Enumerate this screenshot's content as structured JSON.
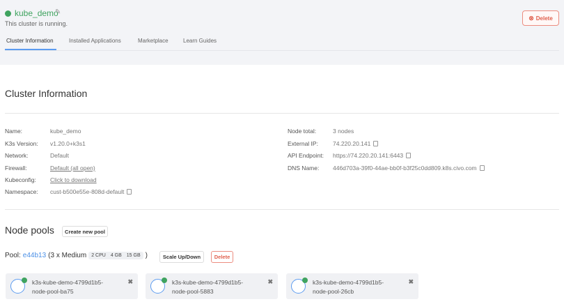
{
  "header": {
    "cluster_name": "kube_demo",
    "status": "This cluster is running.",
    "delete_label": "Delete"
  },
  "tabs": [
    "Cluster Information",
    "Installed Applications",
    "Marketplace",
    "Learn Guides"
  ],
  "info": {
    "heading": "Cluster Information",
    "left": [
      {
        "label": "Name:",
        "value": "kube_demo"
      },
      {
        "label": "K3s Version:",
        "value": "v1.20.0+k3s1"
      },
      {
        "label": "Network:",
        "value": "Default"
      },
      {
        "label": "Firewall:",
        "value": "Default (all open)"
      },
      {
        "label": "Kubeconfig:",
        "value": "Click to download"
      },
      {
        "label": "Namespace:",
        "value": "cust-b500e55e-808d-default"
      }
    ],
    "right": [
      {
        "label": "Node total:",
        "value": "3 nodes"
      },
      {
        "label": "External IP:",
        "value": "74.220.20.141"
      },
      {
        "label": "API Endpoint:",
        "value": "https://74.220.20.141:6443"
      },
      {
        "label": "DNS Name:",
        "value": "446d703a-39f0-44ae-bb0f-b3f25c0dd809.k8s.civo.com"
      }
    ]
  },
  "pools": {
    "heading": "Node pools",
    "create_label": "Create new pool",
    "pool_prefix": "Pool:",
    "pool_id": "e44b13",
    "pool_size": "(3 x Medium",
    "cpu": "2 CPU",
    "ram": "4 GB",
    "disk": "15 GB",
    "close_paren": ")",
    "scale_label": "Scale Up/Down",
    "delete_label": "Delete",
    "nodes": [
      {
        "line1": "k3s-kube-demo-4799d1b5-",
        "line2": "node-pool-ba75"
      },
      {
        "line1": "k3s-kube-demo-4799d1b5-",
        "line2": "node-pool-5883"
      },
      {
        "line1": "k3s-kube-demo-4799d1b5-",
        "line2": "node-pool-26cb"
      }
    ]
  },
  "colors": {
    "accent": "#5b9bf0",
    "running": "#3fa35f",
    "danger": "#e0604e"
  }
}
